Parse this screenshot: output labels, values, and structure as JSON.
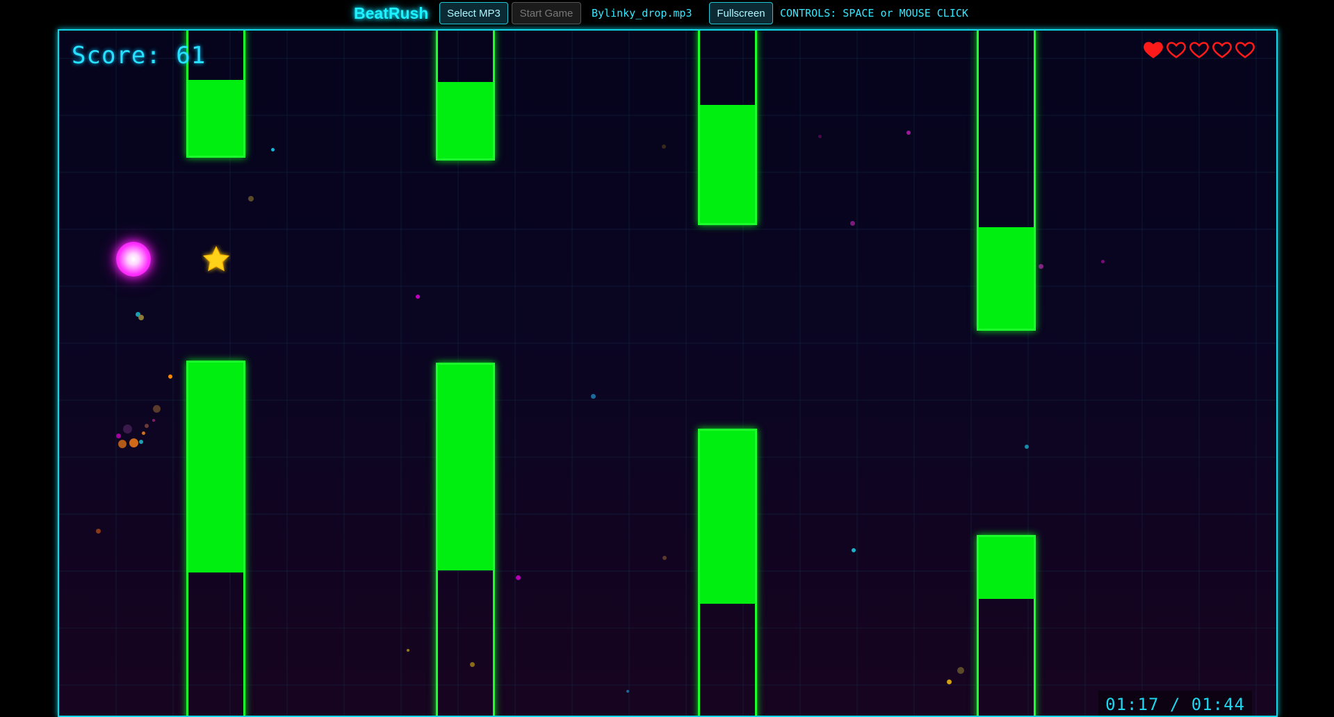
{
  "header": {
    "brand": "BeatRush",
    "select_mp3_label": "Select MP3",
    "start_game_label": "Start Game",
    "file_name": "Bylinky_drop.mp3",
    "fullscreen_label": "Fullscreen",
    "controls_text": "CONTROLS: SPACE or MOUSE CLICK"
  },
  "hud": {
    "score_text": "Score: 61",
    "lives_total": 5,
    "lives_remaining": 1,
    "time_text": "01:17 / 01:44"
  },
  "colors": {
    "accent": "#1ef2ff",
    "pipe": "#00ee10",
    "player": "#ff33ff",
    "heart": "#ff1a1a",
    "star": "#ffd21a"
  },
  "icons": {
    "player": "glowing-ball",
    "collectible": "star-icon",
    "life": "heart-icon"
  }
}
